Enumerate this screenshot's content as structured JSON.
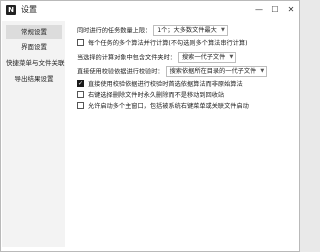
{
  "window": {
    "title": "设置",
    "app_icon_letter": "N",
    "minimize": "—",
    "maximize": "☐",
    "close": "✕"
  },
  "sidebar": {
    "items": [
      {
        "label": "常规设置",
        "active": true
      },
      {
        "label": "界面设置",
        "active": false
      },
      {
        "label": "快捷菜单与文件关联",
        "active": false
      },
      {
        "label": "导出结果设置",
        "active": false
      }
    ]
  },
  "general": {
    "concurrency_label": "同时进行的任务数量上限：",
    "concurrency_value": "1个；大多数文件最大",
    "multi_files_label": "每个任务的多个算法并行计算(不勾选则多个算法串行计算)",
    "multi_files_checked": false,
    "auto_compare_label": "当选择的计算对象中包含文件夹时：",
    "auto_compare_value": "搜索一代子文件",
    "direct_use_label": "直接使用校验依据进行校验时：",
    "direct_use_value": "搜索依据所在目录的一代子文件",
    "options": [
      {
        "label": "直接使用校验依据进行校验时首选依据算法而非原始算法",
        "checked": true
      },
      {
        "label": "右键选择删除文件时永久删除而不是移动到回收站",
        "checked": false
      },
      {
        "label": "允许启动多个主窗口，包括被系统右键菜单或关联文件启动",
        "checked": false
      }
    ]
  }
}
